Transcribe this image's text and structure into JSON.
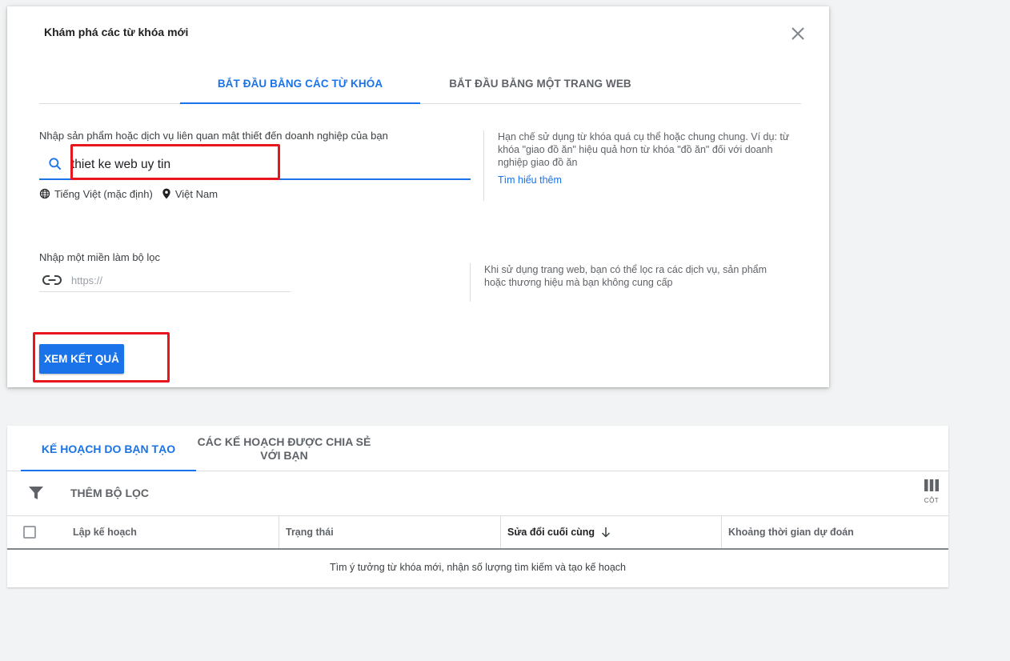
{
  "dialog": {
    "title": "Khám phá các từ khóa mới",
    "tabs": [
      {
        "label": "BẮT ĐẦU BẰNG CÁC TỪ KHÓA",
        "active": true
      },
      {
        "label": "BẮT ĐẦU BẰNG MỘT TRANG WEB",
        "active": false
      }
    ],
    "keywords": {
      "label": "Nhập sản phẩm hoặc dịch vụ liên quan mật thiết đến doanh nghiệp của bạn",
      "value": "thiet ke web uy tin",
      "language": "Tiếng Việt (mặc định)",
      "location": "Việt Nam"
    },
    "tip_keywords": {
      "text": "Hạn chế sử dụng từ khóa quá cụ thể hoặc chung chung. Ví dụ: từ khóa \"giao đồ ăn\" hiệu quả hơn từ khóa \"đồ ăn\" đối với doanh nghiệp giao đồ ăn",
      "link": "Tìm hiểu thêm"
    },
    "domain": {
      "label": "Nhập một miền làm bộ lọc",
      "placeholder": "https://"
    },
    "tip_domain": "Khi sử dụng trang web, bạn có thể lọc ra các dịch vụ, sản phẩm hoặc thương hiệu mà bạn không cung cấp",
    "submit_label": "XEM KẾT QUẢ"
  },
  "plans": {
    "tabs": [
      {
        "label": "KẾ HOẠCH DO BẠN TẠO",
        "active": true
      },
      {
        "label": "CÁC KẾ HOẠCH ĐƯỢC CHIA SẺ VỚI BẠN",
        "active": false
      }
    ],
    "filter_label": "THÊM BỘ LỌC",
    "columns_label": "CỘT",
    "columns": [
      "Lập kế hoạch",
      "Trạng thái",
      "Sửa đổi cuối cùng",
      "Khoảng thời gian dự đoán"
    ],
    "empty_message": "Tìm ý tưởng từ khóa mới, nhận số lượng tìm kiếm và tạo kế hoạch"
  },
  "colors": {
    "accent": "#1a73e8",
    "highlight": "#e8141e"
  },
  "icons": [
    "close-icon",
    "search-icon",
    "globe-icon",
    "location-pin-icon",
    "link-icon",
    "filter-icon",
    "columns-icon",
    "arrow-down-icon"
  ]
}
